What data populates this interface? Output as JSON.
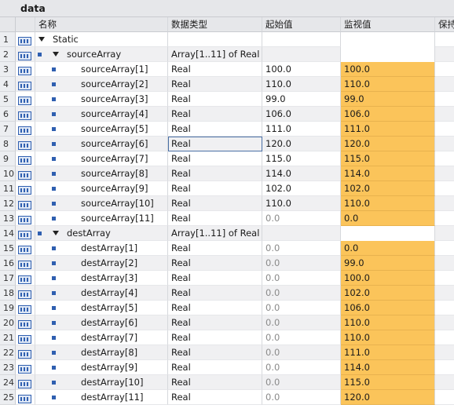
{
  "title": "data",
  "headers": {
    "name": "名称",
    "type": "数据类型",
    "start": "起始值",
    "monitor": "监视值",
    "retain": "保持"
  },
  "rows": [
    {
      "num": "1",
      "name": "Static",
      "level": 0,
      "kind": "section",
      "type": "",
      "start": "",
      "monitor": ""
    },
    {
      "num": "2",
      "name": "sourceArray",
      "level": 1,
      "kind": "array",
      "type": "Array[1..11] of Real",
      "start": "",
      "monitor": ""
    },
    {
      "num": "3",
      "name": "sourceArray[1]",
      "level": 2,
      "kind": "elem",
      "type": "Real",
      "start": "100.0",
      "monitor": "100.0"
    },
    {
      "num": "4",
      "name": "sourceArray[2]",
      "level": 2,
      "kind": "elem",
      "type": "Real",
      "start": "110.0",
      "monitor": "110.0"
    },
    {
      "num": "5",
      "name": "sourceArray[3]",
      "level": 2,
      "kind": "elem",
      "type": "Real",
      "start": "99.0",
      "monitor": "99.0"
    },
    {
      "num": "6",
      "name": "sourceArray[4]",
      "level": 2,
      "kind": "elem",
      "type": "Real",
      "start": "106.0",
      "monitor": "106.0"
    },
    {
      "num": "7",
      "name": "sourceArray[5]",
      "level": 2,
      "kind": "elem",
      "type": "Real",
      "start": "111.0",
      "monitor": "111.0"
    },
    {
      "num": "8",
      "name": "sourceArray[6]",
      "level": 2,
      "kind": "elem",
      "type": "Real",
      "start": "120.0",
      "monitor": "120.0",
      "selected": true
    },
    {
      "num": "9",
      "name": "sourceArray[7]",
      "level": 2,
      "kind": "elem",
      "type": "Real",
      "start": "115.0",
      "monitor": "115.0"
    },
    {
      "num": "10",
      "name": "sourceArray[8]",
      "level": 2,
      "kind": "elem",
      "type": "Real",
      "start": "114.0",
      "monitor": "114.0"
    },
    {
      "num": "11",
      "name": "sourceArray[9]",
      "level": 2,
      "kind": "elem",
      "type": "Real",
      "start": "102.0",
      "monitor": "102.0"
    },
    {
      "num": "12",
      "name": "sourceArray[10]",
      "level": 2,
      "kind": "elem",
      "type": "Real",
      "start": "110.0",
      "monitor": "110.0"
    },
    {
      "num": "13",
      "name": "sourceArray[11]",
      "level": 2,
      "kind": "elem",
      "type": "Real",
      "start": "0.0",
      "monitor": "0.0",
      "startGray": true
    },
    {
      "num": "14",
      "name": "destArray",
      "level": 1,
      "kind": "array",
      "type": "Array[1..11] of Real",
      "start": "",
      "monitor": ""
    },
    {
      "num": "15",
      "name": "destArray[1]",
      "level": 2,
      "kind": "elem",
      "type": "Real",
      "start": "0.0",
      "monitor": "0.0",
      "startGray": true
    },
    {
      "num": "16",
      "name": "destArray[2]",
      "level": 2,
      "kind": "elem",
      "type": "Real",
      "start": "0.0",
      "monitor": "99.0",
      "startGray": true
    },
    {
      "num": "17",
      "name": "destArray[3]",
      "level": 2,
      "kind": "elem",
      "type": "Real",
      "start": "0.0",
      "monitor": "100.0",
      "startGray": true
    },
    {
      "num": "18",
      "name": "destArray[4]",
      "level": 2,
      "kind": "elem",
      "type": "Real",
      "start": "0.0",
      "monitor": "102.0",
      "startGray": true
    },
    {
      "num": "19",
      "name": "destArray[5]",
      "level": 2,
      "kind": "elem",
      "type": "Real",
      "start": "0.0",
      "monitor": "106.0",
      "startGray": true
    },
    {
      "num": "20",
      "name": "destArray[6]",
      "level": 2,
      "kind": "elem",
      "type": "Real",
      "start": "0.0",
      "monitor": "110.0",
      "startGray": true
    },
    {
      "num": "21",
      "name": "destArray[7]",
      "level": 2,
      "kind": "elem",
      "type": "Real",
      "start": "0.0",
      "monitor": "110.0",
      "startGray": true
    },
    {
      "num": "22",
      "name": "destArray[8]",
      "level": 2,
      "kind": "elem",
      "type": "Real",
      "start": "0.0",
      "monitor": "111.0",
      "startGray": true
    },
    {
      "num": "23",
      "name": "destArray[9]",
      "level": 2,
      "kind": "elem",
      "type": "Real",
      "start": "0.0",
      "monitor": "114.0",
      "startGray": true
    },
    {
      "num": "24",
      "name": "destArray[10]",
      "level": 2,
      "kind": "elem",
      "type": "Real",
      "start": "0.0",
      "monitor": "115.0",
      "startGray": true
    },
    {
      "num": "25",
      "name": "destArray[11]",
      "level": 2,
      "kind": "elem",
      "type": "Real",
      "start": "0.0",
      "monitor": "120.0",
      "startGray": true
    }
  ],
  "colors": {
    "monitor_highlight": "#fbc45a",
    "icon_blue": "#2f5fb0",
    "header_bg": "#e6e7ea"
  }
}
